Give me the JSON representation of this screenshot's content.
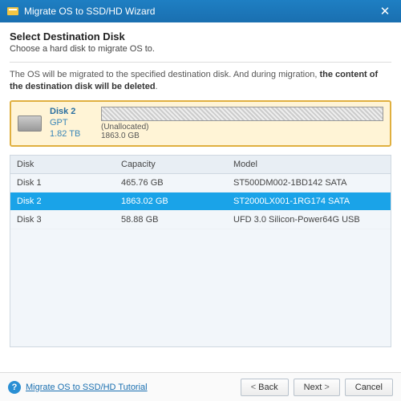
{
  "window": {
    "title": "Migrate OS to SSD/HD Wizard"
  },
  "page": {
    "heading": "Select Destination Disk",
    "subheading": "Choose a hard disk to migrate OS to.",
    "warning_prefix": "The OS will be migrated to the specified destination disk. And during migration, ",
    "warning_bold": "the content of the destination disk will be deleted",
    "warning_suffix": "."
  },
  "selected_disk": {
    "name": "Disk 2",
    "type": "GPT",
    "size": "1.82 TB",
    "segment_label": "(Unallocated)",
    "segment_size": "1863.0 GB"
  },
  "table": {
    "headers": {
      "disk": "Disk",
      "capacity": "Capacity",
      "model": "Model"
    },
    "rows": [
      {
        "disk": "Disk 1",
        "capacity": "465.76 GB",
        "model": "ST500DM002-1BD142 SATA",
        "selected": false
      },
      {
        "disk": "Disk 2",
        "capacity": "1863.02 GB",
        "model": "ST2000LX001-1RG174 SATA",
        "selected": true
      },
      {
        "disk": "Disk 3",
        "capacity": "58.88 GB",
        "model": "UFD 3.0 Silicon-Power64G USB",
        "selected": false
      }
    ]
  },
  "footer": {
    "help_label": "Migrate OS to SSD/HD Tutorial",
    "back": "Back",
    "next": "Next",
    "cancel": "Cancel"
  }
}
